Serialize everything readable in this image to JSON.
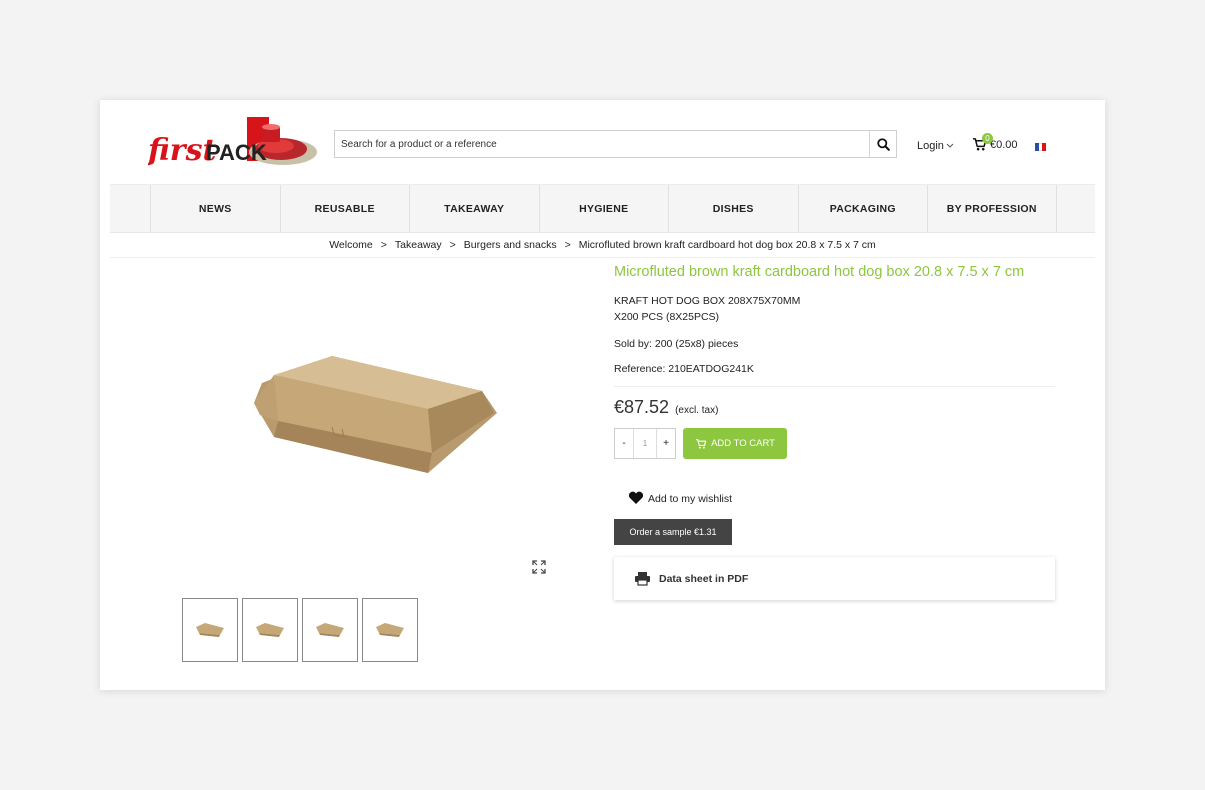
{
  "header": {
    "logo_text_first": "first",
    "logo_text_pack": "PACK",
    "search_placeholder": "Search for a product or a reference",
    "login_label": "Login",
    "cart_count": "0",
    "cart_total": "€0.00",
    "language": "fr"
  },
  "nav": {
    "items": [
      {
        "label": "NEWS"
      },
      {
        "label": "REUSABLE"
      },
      {
        "label": "TAKEAWAY"
      },
      {
        "label": "HYGIENE"
      },
      {
        "label": "DISHES"
      },
      {
        "label": "PACKAGING"
      },
      {
        "label": "BY PROFESSION"
      }
    ]
  },
  "breadcrumb": {
    "items": [
      "Welcome",
      "Takeaway",
      "Burgers and snacks",
      "Microfluted brown kraft cardboard hot dog box 20.8 x 7.5 x 7 cm"
    ],
    "separator": ">"
  },
  "product": {
    "title": "Microfluted brown kraft cardboard hot dog box 20.8 x 7.5 x 7 cm",
    "desc_line1": "KRAFT HOT DOG BOX 208X75X70MM",
    "desc_line2": "X200 PCS (8X25PCS)",
    "sold_by": "Sold by: 200 (25x8) pieces",
    "reference": "Reference: 210EATDOG241K",
    "price": "€87.52",
    "tax_note": "(excl. tax)",
    "qty_minus": "-",
    "qty_value": "1",
    "qty_plus": "+",
    "add_to_cart": "ADD TO CART",
    "wishlist": "Add to my wishlist",
    "sample": "Order a sample €1.31",
    "datasheet": "Data sheet in PDF"
  },
  "colors": {
    "accent": "#8dc63f",
    "logo_red": "#d7141a",
    "dark_button": "#444444"
  }
}
